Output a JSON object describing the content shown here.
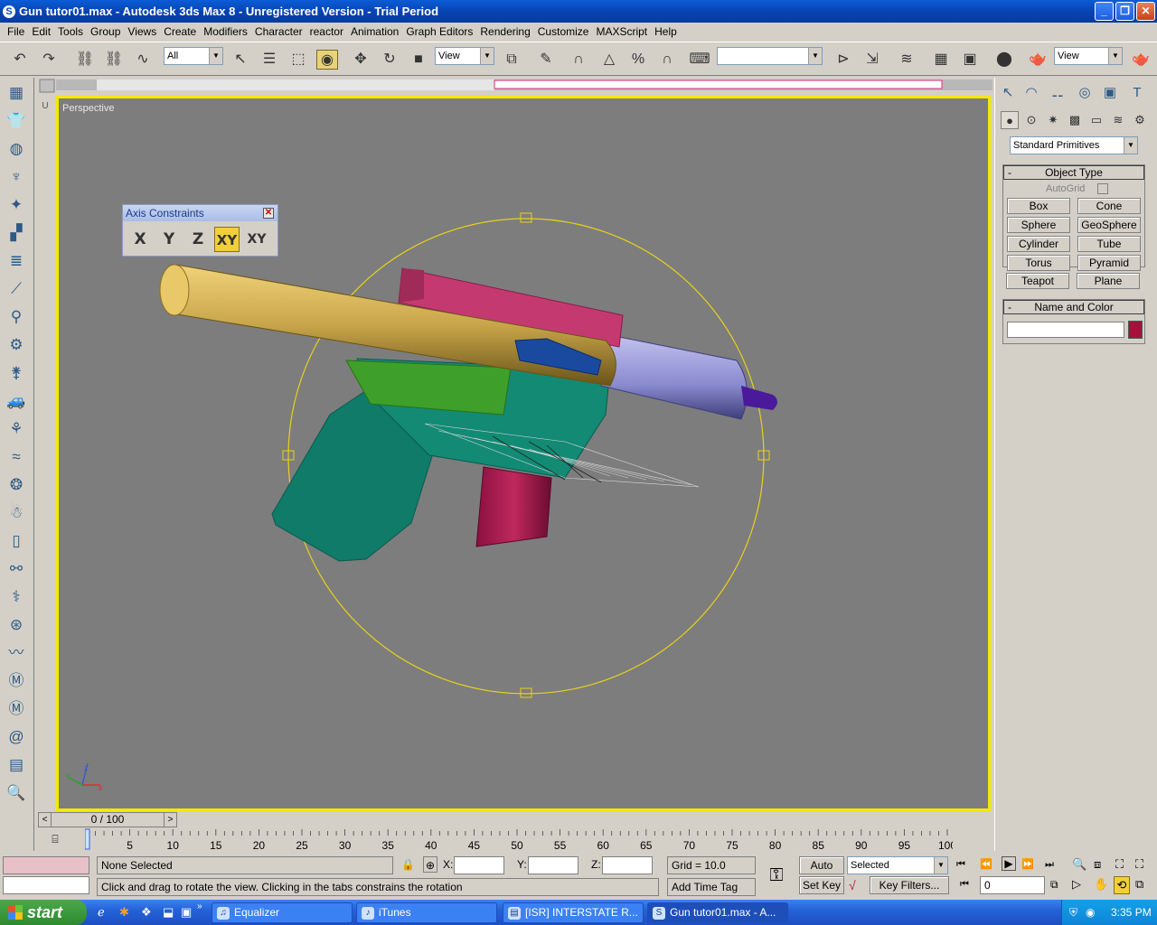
{
  "window": {
    "title": "Gun tutor01.max - Autodesk 3ds Max 8 - Unregistered Version - Trial Period"
  },
  "menu": [
    "File",
    "Edit",
    "Tools",
    "Group",
    "Views",
    "Create",
    "Modifiers",
    "Character",
    "reactor",
    "Animation",
    "Graph Editors",
    "Rendering",
    "Customize",
    "MAXScript",
    "Help"
  ],
  "toolbar": {
    "selection_filter": "All",
    "ref_coord": "View",
    "render_view": "View",
    "named_sel": ""
  },
  "viewport": {
    "label": "Perspective"
  },
  "axis_constraints": {
    "title": "Axis Constraints",
    "buttons": [
      "X",
      "Y",
      "Z",
      "XY",
      "XY"
    ],
    "active": "XY"
  },
  "command_panel": {
    "category": "Standard Primitives",
    "object_type": {
      "title": "Object Type",
      "autogrid": "AutoGrid",
      "buttons": [
        "Box",
        "Cone",
        "Sphere",
        "GeoSphere",
        "Cylinder",
        "Tube",
        "Torus",
        "Pyramid",
        "Teapot",
        "Plane"
      ]
    },
    "name_color": {
      "title": "Name and Color",
      "name_value": "",
      "color": "#a0143c"
    }
  },
  "time_slider": {
    "value": "0 / 100"
  },
  "timeline": {
    "labels": [
      "5",
      "10",
      "15",
      "20",
      "25",
      "30",
      "35",
      "40",
      "45",
      "50",
      "55",
      "60",
      "65",
      "70",
      "75",
      "80",
      "85",
      "90",
      "95",
      "100"
    ]
  },
  "status": {
    "selection": "None Selected",
    "prompt": "Click and drag to rotate the view.  Clicking in the tabs constrains the rotation",
    "x_label": "X:",
    "y_label": "Y:",
    "z_label": "Z:",
    "x_value": "",
    "y_value": "",
    "z_value": "",
    "grid": "Grid = 10.0",
    "add_time_tag": "Add Time Tag",
    "auto_key": "Auto Key",
    "set_key": "Set Key",
    "key_mode": "Selected",
    "key_filters": "Key Filters...",
    "current_frame": "0"
  },
  "taskbar": {
    "start": "start",
    "tasks": [
      "Equalizer",
      "iTunes",
      "[ISR] INTERSTATE R...",
      "Gun tutor01.max - A..."
    ],
    "clock": "3:35 PM"
  }
}
